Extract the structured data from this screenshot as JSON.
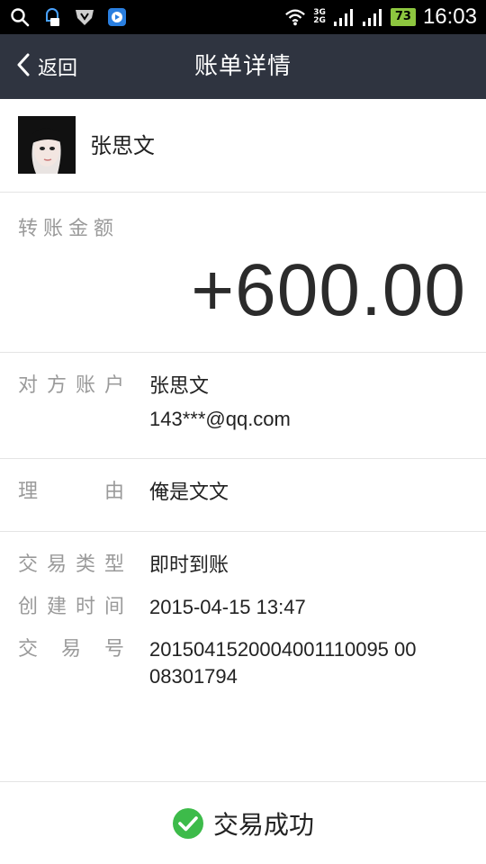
{
  "status_bar": {
    "time": "16:03",
    "battery": "73",
    "network": [
      "3G",
      "2G"
    ],
    "icons": [
      "search-icon",
      "notification-icon",
      "shield-icon",
      "media-icon",
      "wifi-icon",
      "signal-icon"
    ]
  },
  "nav": {
    "back_label": "返回",
    "title": "账单详情"
  },
  "user": {
    "name": "张思文"
  },
  "amount": {
    "label": "转账金额",
    "value": "+600.00"
  },
  "counterparty": {
    "label_chars": [
      "对",
      "方",
      "账",
      "户"
    ],
    "name": "张思文",
    "account": "143***@qq.com"
  },
  "reason": {
    "label_chars": [
      "理",
      "由"
    ],
    "value": "俺是文文"
  },
  "transaction": {
    "type_label_chars": [
      "交",
      "易",
      "类",
      "型"
    ],
    "type_value": "即时到账",
    "created_label_chars": [
      "创",
      "建",
      "时",
      "间"
    ],
    "created_value": "2015-04-15 13:47",
    "number_label_chars": [
      "交",
      "易",
      "号"
    ],
    "number_line1": "2015041520004001110095 00",
    "number_line2": "08301794"
  },
  "footer": {
    "status": "交易成功",
    "accent": "#3dbb4a"
  }
}
